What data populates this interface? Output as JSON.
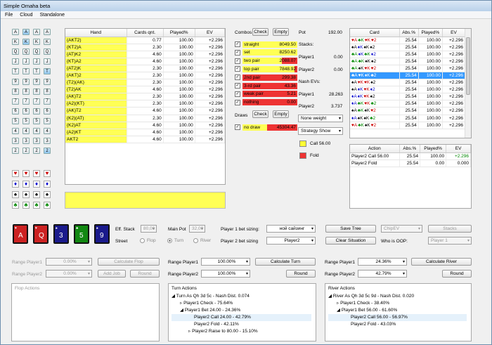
{
  "window": {
    "title": "Simple Omaha beta"
  },
  "menu": [
    "File",
    "Cloud",
    "Standalone"
  ],
  "ranks": [
    "A",
    "K",
    "Q",
    "J",
    "T",
    "9",
    "8",
    "7",
    "6",
    "5",
    "4",
    "3",
    "2"
  ],
  "suits": [
    [
      "♥",
      "♥",
      "♥",
      "♥"
    ],
    [
      "♦",
      "♦",
      "♦",
      "♦"
    ],
    [
      "♠",
      "♠",
      "♠",
      "♠"
    ],
    [
      "♣",
      "♣",
      "♣",
      "♣"
    ]
  ],
  "hand_table": {
    "headers": [
      "Hand",
      "Cards qnt.",
      "Played%",
      "EV"
    ],
    "rows": [
      [
        "(AKT2)",
        "0.77",
        "100.00",
        "+2.296"
      ],
      [
        "(KT2)A",
        "2.30",
        "100.00",
        "+2.296"
      ],
      [
        "(AT)K2",
        "4.60",
        "100.00",
        "+2.296"
      ],
      [
        "(KT)A2",
        "4.60",
        "100.00",
        "+2.296"
      ],
      [
        "(AT2)K",
        "2.30",
        "100.00",
        "+2.296"
      ],
      [
        "(AKT)2",
        "2.30",
        "100.00",
        "+2.296"
      ],
      [
        "(T2)(AK)",
        "2.30",
        "100.00",
        "+2.296"
      ],
      [
        "(T2)AK",
        "4.60",
        "100.00",
        "+2.296"
      ],
      [
        "(AK)T2",
        "2.30",
        "100.00",
        "+2.296"
      ],
      [
        "(A2)(KT)",
        "2.30",
        "100.00",
        "+2.296"
      ],
      [
        "(AK)T2",
        "4.60",
        "100.00",
        "+2.296"
      ],
      [
        "(K2)(AT)",
        "2.30",
        "100.00",
        "+2.296"
      ],
      [
        "(K2)AT",
        "4.60",
        "100.00",
        "+2.296"
      ],
      [
        "(A2)KT",
        "4.60",
        "100.00",
        "+2.296"
      ],
      [
        "AKT2",
        "4.60",
        "100.00",
        "+2.296"
      ]
    ]
  },
  "combos": {
    "title": "Combos",
    "check": "Check",
    "empty": "Empty",
    "items": [
      {
        "label": "straight",
        "value": "8049.50",
        "red": 0
      },
      {
        "label": "set",
        "value": "8250.62",
        "red": 0
      },
      {
        "label": "two pair",
        "value": "2088.07",
        "red": 0.28
      },
      {
        "label": "top pair",
        "value": "7848.92",
        "red": 0.05
      },
      {
        "label": "2nd pair",
        "value": "299.38",
        "red": 1
      },
      {
        "label": "3-rd pair",
        "value": "43.36",
        "red": 1
      },
      {
        "label": "weak pair",
        "value": "5.21",
        "red": 1
      },
      {
        "label": "nothing",
        "value": "0.00",
        "red": 1
      }
    ]
  },
  "draws": {
    "title": "Draws",
    "check": "Check",
    "empty": "Empty",
    "items": [
      {
        "label": "no draw",
        "value": "45304.47",
        "red": 0.55
      }
    ]
  },
  "stats": {
    "pot_label": "Pot",
    "pot": "192.00",
    "stacks_label": "Stacks:",
    "p1": "Player1",
    "p1v": "0.00",
    "p2": "Player2",
    "p2v": "0.00",
    "nash": "Nash EVs:",
    "n1": "Player1",
    "n1v": "28.263",
    "n2": "Player2",
    "n2v": "3.737"
  },
  "weight_dd": "None weight",
  "strategy_dd": "Strategy Show",
  "legend_call": "Call 56.00",
  "legend_fold": "Fold",
  "card_table": {
    "headers": [
      "Card",
      "Abs.%",
      "Played%",
      "EV"
    ],
    "row": [
      "25.54",
      "100.00",
      "+2.296"
    ],
    "cards": [
      [
        [
          "♥",
          "A",
          "#c00"
        ],
        [
          "♣",
          "K",
          "#080"
        ],
        [
          "♥",
          "K",
          "#c00"
        ],
        [
          "♥",
          "2",
          "#c00"
        ]
      ],
      [
        [
          "♠",
          "A",
          "#000"
        ],
        [
          "♦",
          "K",
          "#00c"
        ],
        [
          "♠",
          "K",
          "#000"
        ],
        [
          "♠",
          "2",
          "#000"
        ]
      ],
      [
        [
          "♣",
          "A",
          "#080"
        ],
        [
          "♦",
          "K",
          "#00c"
        ],
        [
          "♣",
          "K",
          "#080"
        ],
        [
          "♦",
          "2",
          "#00c"
        ]
      ],
      [
        [
          "♣",
          "A",
          "#080"
        ],
        [
          "♣",
          "K",
          "#080"
        ],
        [
          "♠",
          "K",
          "#000"
        ],
        [
          "♠",
          "2",
          "#000"
        ]
      ],
      [
        [
          "♣",
          "A",
          "#080"
        ],
        [
          "♠",
          "K",
          "#000"
        ],
        [
          "♥",
          "K",
          "#c00"
        ],
        [
          "♥",
          "2",
          "#c00"
        ]
      ],
      [
        [
          "♣",
          "A",
          "#080"
        ],
        [
          "♥",
          "K",
          "#c00"
        ],
        [
          "♦",
          "K",
          "#00c"
        ],
        [
          "♣",
          "2",
          "#080"
        ]
      ],
      [
        [
          "♠",
          "A",
          "#000"
        ],
        [
          "♥",
          "K",
          "#c00"
        ],
        [
          "♥",
          "K",
          "#c00"
        ],
        [
          "♠",
          "2",
          "#000"
        ]
      ],
      [
        [
          "♠",
          "A",
          "#000"
        ],
        [
          "♦",
          "K",
          "#00c"
        ],
        [
          "♥",
          "K",
          "#c00"
        ],
        [
          "♦",
          "2",
          "#00c"
        ]
      ],
      [
        [
          "♦",
          "A",
          "#00c"
        ],
        [
          "♦",
          "K",
          "#00c"
        ],
        [
          "♥",
          "K",
          "#c00"
        ],
        [
          "♠",
          "2",
          "#000"
        ]
      ],
      [
        [
          "♦",
          "A",
          "#00c"
        ],
        [
          "♣",
          "K",
          "#080"
        ],
        [
          "♥",
          "K",
          "#c00"
        ],
        [
          "♣",
          "2",
          "#080"
        ]
      ],
      [
        [
          "♠",
          "A",
          "#000"
        ],
        [
          "♣",
          "K",
          "#080"
        ],
        [
          "♠",
          "K",
          "#000"
        ],
        [
          "♥",
          "2",
          "#c00"
        ]
      ],
      [
        [
          "♦",
          "A",
          "#00c"
        ],
        [
          "♠",
          "K",
          "#000"
        ],
        [
          "♠",
          "K",
          "#000"
        ],
        [
          "♣",
          "2",
          "#080"
        ]
      ],
      [
        [
          "♥",
          "A",
          "#c00"
        ],
        [
          "♣",
          "K",
          "#080"
        ],
        [
          "♠",
          "K",
          "#000"
        ],
        [
          "♥",
          "2",
          "#c00"
        ]
      ]
    ]
  },
  "action_table": {
    "headers": [
      "Action",
      "Abs.%",
      "Played%",
      "EV"
    ],
    "rows": [
      [
        "Player2 Call 56.00",
        "25.54",
        "100.00",
        "+2.296"
      ],
      [
        "Player2 Fold",
        "25.54",
        "0.00",
        "0.000"
      ]
    ]
  },
  "board": [
    {
      "r": "A",
      "s": "♥",
      "bg": "#cc2222"
    },
    {
      "r": "Q",
      "s": "♥",
      "bg": "#cc2222"
    },
    {
      "r": "3",
      "s": "♠",
      "bg": "#1a1a8c"
    },
    {
      "r": "5",
      "s": "♣",
      "bg": "#118811"
    },
    {
      "r": "9",
      "s": "♠",
      "bg": "#1a1a8c"
    }
  ],
  "controls": {
    "eff_stack": "Eff. Stack",
    "eff_stack_v": "80,00",
    "main_pot": "Main Pot",
    "main_pot_v": "32,00",
    "street": "Street",
    "flop": "Flop",
    "turn": "Turn",
    "river": "River",
    "p1_sizing": "Player 1 bet sizing:",
    "p1_sizing_v": "ной сайзинг",
    "p2_sizing": "Player 2 bet sizing",
    "p2_sizing_v": "Player2",
    "save_tree": "Save Tree",
    "clear": "Clear Situation",
    "chipev": "ChipEV",
    "stacks": "Stacks",
    "oop": "Who is OOP:",
    "oop_v": "Player 1"
  },
  "flop": {
    "r1": "Range Player1",
    "r1v": "0.00%",
    "calc": "Calculate Flop",
    "r2": "Range Player2",
    "r2v": "0.00%",
    "add": "Add Job",
    "round": "Round",
    "actions": "Flop Actions"
  },
  "turn": {
    "r1": "Range Player1",
    "r1v": "100.00%",
    "calc": "Calculate Turn",
    "r2": "Range Player2",
    "r2v": "100.00%",
    "round": "Round",
    "actions": "Turn Actions",
    "tree": [
      "Turn As Qh 3d 5c - Nash Dist. 0.074",
      "Player1 Check - 75.64%",
      "Player1 Bet 24.00 - 24.36%",
      "Player2 Call 24.00 - 42.79%",
      "Player2 Fold - 42.11%",
      "Player2 Raise to 80.00 - 15.10%"
    ]
  },
  "river": {
    "r1": "Range Player1",
    "r1v": "24.36%",
    "calc": "Calculate River",
    "r2": "Range Player2",
    "r2v": "42.79%",
    "round": "Round",
    "actions": "River Actions",
    "tree": [
      "River As Qh 3d 5c 9d - Nash Dist. 0.020",
      "Player1 Check - 38.40%",
      "Player1 Bet 56.00 - 61.60%",
      "Player2 Call 56.00 - 56.97%",
      "Player2 Fold - 43.03%"
    ]
  }
}
